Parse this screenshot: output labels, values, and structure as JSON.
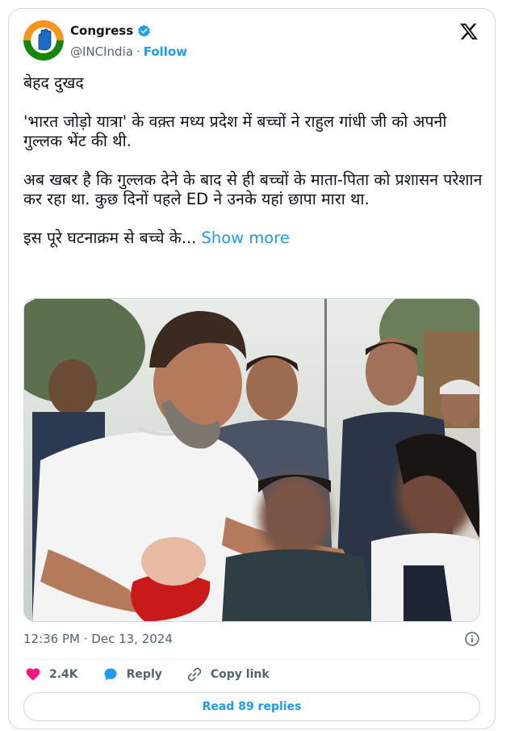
{
  "author": {
    "display_name": "Congress",
    "handle": "@INCIndia",
    "separator": "·",
    "follow_label": "Follow",
    "verified": true,
    "brand_colors": {
      "saffron": "#f7941d",
      "green": "#138808",
      "accent": "#1d9bf0"
    }
  },
  "tweet": {
    "paragraphs": [
      "बेहद दुखद",
      "'भारत जोड़ो यात्रा' के वक़्त मध्य प्रदेश में बच्चों ने राहुल गांधी जी को अपनी गुल्लक भेंट की थी.",
      "अब खबर है कि गुल्लक देने के बाद से ही बच्चों के माता-पिता को प्रशासन परेशान कर रहा था. कुछ दिनों पहले ED ने उनके यहां छापा मारा था."
    ],
    "truncated_text": "इस पूरे घटनाक्रम से बच्चे के...",
    "show_more_label": "Show more",
    "timestamp": "12:36 PM · Dec 13, 2024"
  },
  "actions": {
    "likes": "2.4K",
    "reply_label": "Reply",
    "copy_link_label": "Copy link",
    "read_replies_label": "Read 89 replies"
  },
  "icons": [
    "congress-hand-logo-icon",
    "verified-badge-icon",
    "x-logo-icon",
    "info-icon",
    "heart-icon",
    "reply-bubble-icon",
    "link-icon"
  ]
}
